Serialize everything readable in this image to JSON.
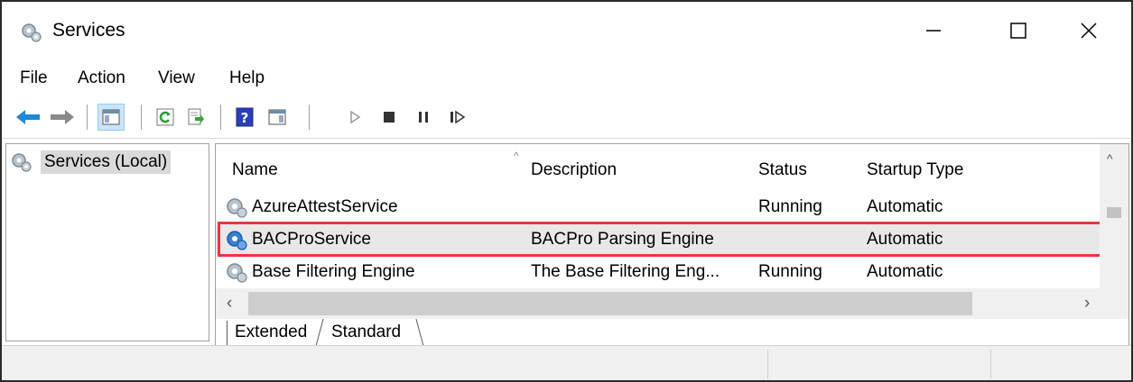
{
  "window": {
    "title": "Services",
    "icon": "services-gear-icon",
    "controls": [
      "minimize-icon",
      "maximize-icon",
      "close-icon"
    ]
  },
  "menu": {
    "items": [
      "File",
      "Action",
      "View",
      "Help"
    ]
  },
  "toolbar": {
    "buttons": [
      {
        "name": "back-arrow-icon",
        "state": "enabled"
      },
      {
        "name": "forward-arrow-icon",
        "state": "enabled"
      },
      {
        "name": "show-hide-console-tree-icon",
        "state": "pressed"
      },
      {
        "name": "refresh-icon",
        "state": "enabled"
      },
      {
        "name": "export-list-icon",
        "state": "enabled"
      },
      {
        "name": "help-icon",
        "state": "enabled"
      },
      {
        "name": "show-action-pane-icon",
        "state": "enabled"
      },
      {
        "name": "start-service-icon",
        "state": "disabled"
      },
      {
        "name": "stop-service-icon",
        "state": "enabled"
      },
      {
        "name": "pause-service-icon",
        "state": "enabled"
      },
      {
        "name": "restart-service-icon",
        "state": "enabled"
      }
    ]
  },
  "tree": {
    "root_label": "Services (Local)",
    "root_icon": "services-gear-icon"
  },
  "list": {
    "columns": [
      "Name",
      "Description",
      "Status",
      "Startup Type"
    ],
    "rows": [
      {
        "name": "AzureAttestService",
        "description": "",
        "status": "Running",
        "startup_type": "Automatic",
        "selected": false
      },
      {
        "name": "BACProService",
        "description": "BACPro Parsing Engine",
        "status": "",
        "startup_type": "Automatic",
        "selected": true
      },
      {
        "name": "Base Filtering Engine",
        "description": "The Base Filtering Eng...",
        "status": "Running",
        "startup_type": "Automatic",
        "selected": false
      }
    ],
    "highlight_color": "#e8373f",
    "selected_row_color": "#e8e8e8"
  },
  "tabs": {
    "items": [
      "Extended",
      "Standard"
    ],
    "active": "Standard"
  },
  "colors": {
    "accent_blue": "#1e88d6",
    "pressed_bg": "#cce4f7"
  }
}
